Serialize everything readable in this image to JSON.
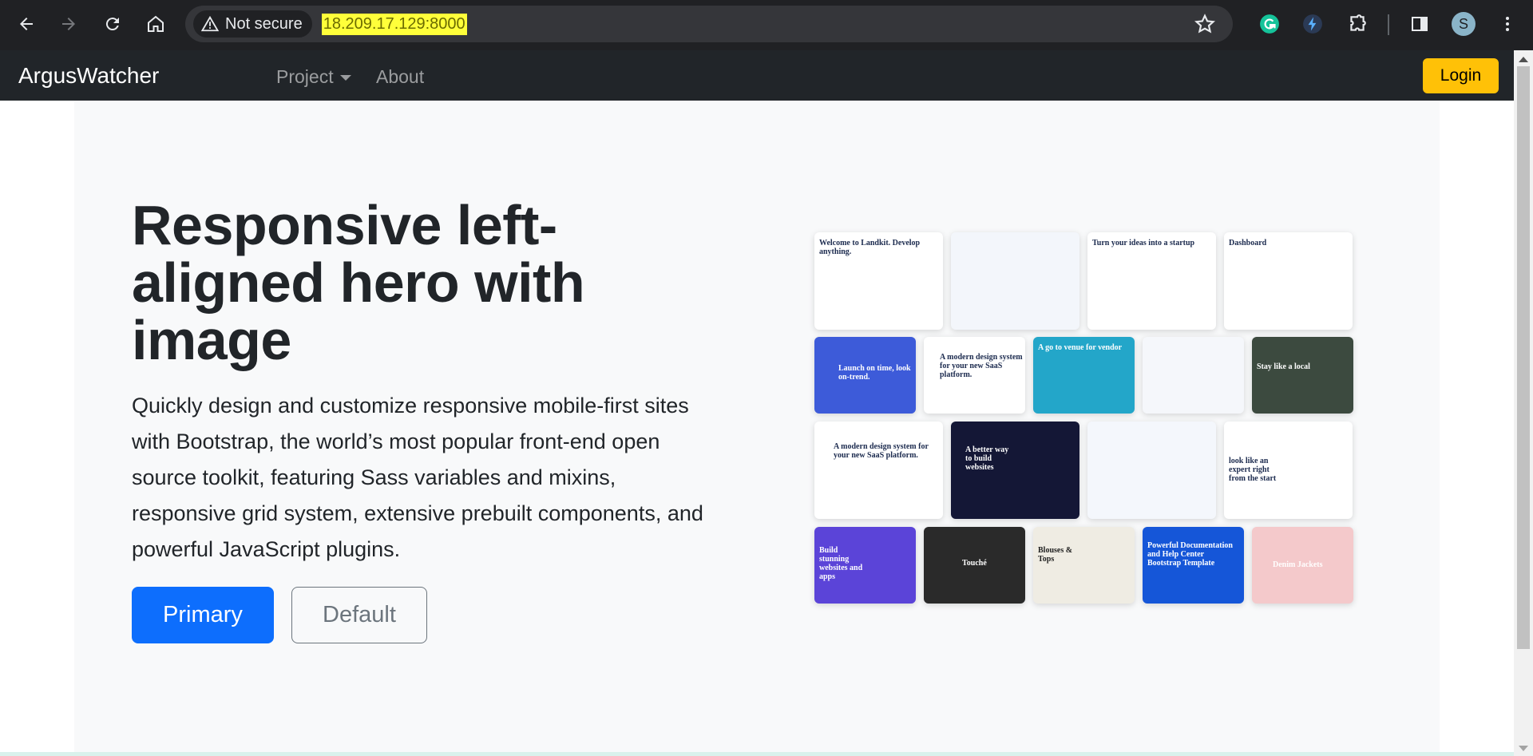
{
  "browser": {
    "security_label": "Not secure",
    "url": "18.209.17.129:8000",
    "profile_initial": "S"
  },
  "navbar": {
    "brand": "ArgusWatcher",
    "project_label": "Project",
    "about_label": "About",
    "login_label": "Login"
  },
  "hero": {
    "title": "Responsive left-aligned hero with image",
    "lead": "Quickly design and customize responsive mobile-first sites with Bootstrap, the world’s most popular front-end open source toolkit, featuring Sass variables and mixins, responsive grid system, extensive prebuilt components, and powerful JavaScript plugins.",
    "primary_label": "Primary",
    "default_label": "Default"
  },
  "collage": {
    "tiles": [
      {
        "caption": "Welcome to Landkit. Develop anything.",
        "bg": "#ffffff",
        "fg": "#1b2a4e"
      },
      {
        "caption": "",
        "bg": "#f3f6fb",
        "fg": "#1b2a4e"
      },
      {
        "caption": "Turn your ideas into a startup",
        "bg": "#ffffff",
        "fg": "#1b2a4e"
      },
      {
        "caption": "Dashboard",
        "bg": "#ffffff",
        "fg": "#1b2a4e"
      },
      {
        "caption": "Launch on time, look on-trend.",
        "bg": "#3d5bd9",
        "fg": "#ffffff"
      },
      {
        "caption": "A modern design system for your new SaaS platform.",
        "bg": "#ffffff",
        "fg": "#1b2a4e"
      },
      {
        "caption": "A go to venue for vendor",
        "bg": "#23a6c9",
        "fg": "#ffffff"
      },
      {
        "caption": "",
        "bg": "#f5f7fb",
        "fg": "#1b2a4e"
      },
      {
        "caption": "Stay like a local",
        "bg": "#3c4a3f",
        "fg": "#ffffff"
      },
      {
        "caption": "A modern design system for your new SaaS platform.",
        "bg": "#ffffff",
        "fg": "#1b2a4e"
      },
      {
        "caption": "A better way to build websites",
        "bg": "#141736",
        "fg": "#ffffff"
      },
      {
        "caption": "",
        "bg": "#f4f7fc",
        "fg": "#1b2a4e"
      },
      {
        "caption": "look like an expert right from the start",
        "bg": "#ffffff",
        "fg": "#1b2a4e"
      },
      {
        "caption": "Build stunning websites and apps",
        "bg": "#5b44d8",
        "fg": "#ffffff"
      },
      {
        "caption": "Touché",
        "bg": "#2a2a2a",
        "fg": "#ffffff"
      },
      {
        "caption": "Blouses & Tops",
        "bg": "#efece3",
        "fg": "#222222"
      },
      {
        "caption": "Powerful Documentation and Help Center Bootstrap Template",
        "bg": "#1556d8",
        "fg": "#ffffff"
      },
      {
        "caption": "Denim Jackets",
        "bg": "#f4c9cb",
        "fg": "#ffffff"
      }
    ]
  }
}
